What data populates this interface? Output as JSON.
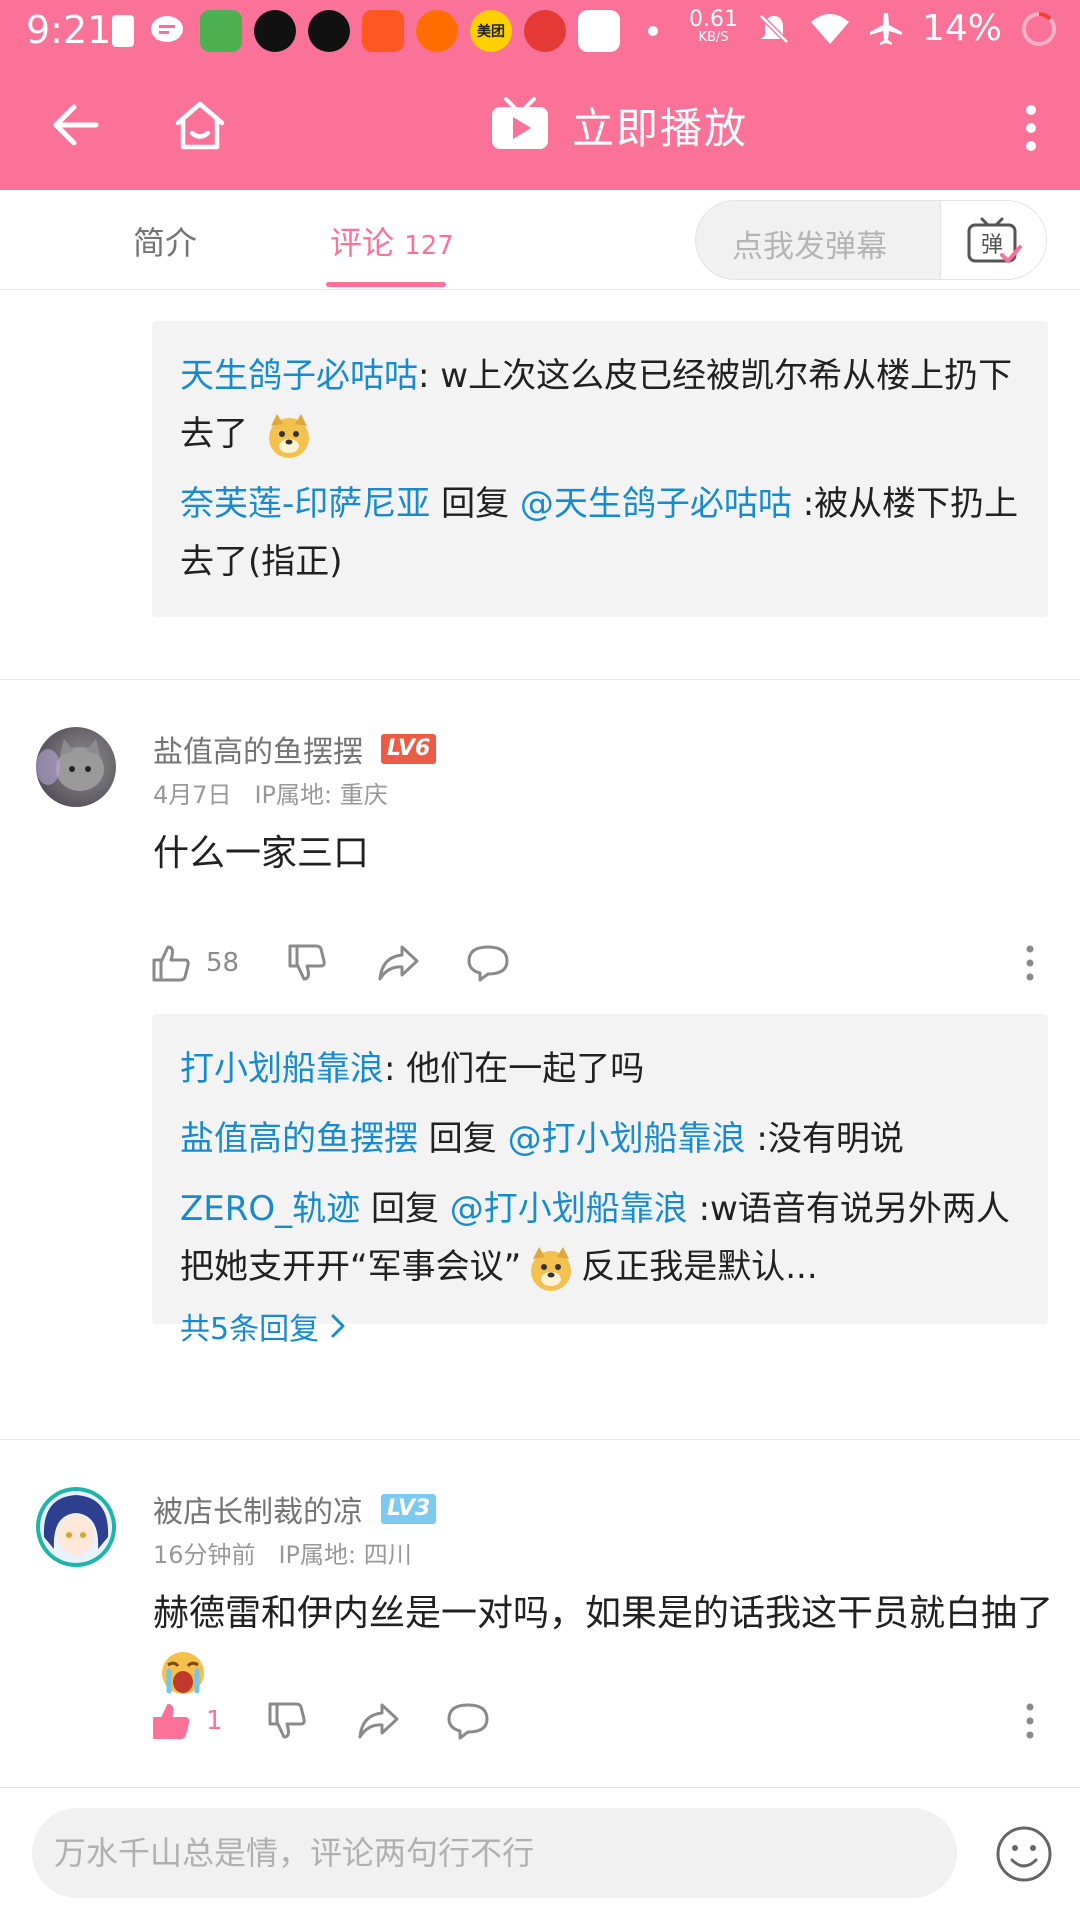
{
  "status": {
    "time": "9:21",
    "net_speed_value": "0.61",
    "net_speed_unit": "KB/S",
    "battery": "14%",
    "meituan_label": "美团"
  },
  "header": {
    "title": "立即播放"
  },
  "tabs": {
    "intro": "简介",
    "comments": "评论",
    "comments_count": "127",
    "danmaku_placeholder": "点我发弹幕",
    "danmaku_icon_char": "弹"
  },
  "top_replies": [
    {
      "user": "天生鸽子必咕咕",
      "text": ": w上次这么皮已经被凯尔希从楼上扔下去了"
    },
    {
      "user": "奈芙莲-印萨尼亚",
      "reply_word": " 回复 ",
      "target": "@天生鸽子必咕咕",
      "text": " :被从楼下扔上去了(指正)"
    }
  ],
  "comments": [
    {
      "user": "盐值高的鱼摆摆",
      "level": "LV6",
      "level_color": "#ee5b45",
      "date": "4月7日",
      "ip": "IP属地: 重庆",
      "text": "什么一家三口",
      "likes": "58",
      "replies": [
        {
          "user": "打小划船靠浪",
          "text": ": 他们在一起了吗"
        },
        {
          "user": "盐值高的鱼摆摆",
          "reply_word": " 回复 ",
          "target": "@打小划船靠浪",
          "text": " :没有明说"
        },
        {
          "user": "ZERO_轨迹",
          "reply_word": " 回复 ",
          "target": "@打小划船靠浪",
          "text": " :w语音有说另外两人把她支开开“军事会议”",
          "text2": "反正我是默认..."
        }
      ],
      "all_replies": "共5条回复"
    },
    {
      "user": "被店长制裁的凉",
      "level": "LV3",
      "level_color": "#7ccaf0",
      "date": "16分钟前",
      "ip": "IP属地: 四川",
      "text": "赫德雷和伊内丝是一对吗，如果是的话我这干员就白抽了",
      "likes": "1"
    }
  ],
  "bottom": {
    "placeholder": "万水千山总是情，评论两句行不行"
  },
  "colors": {
    "brand_pink": "#fb7299",
    "link_blue": "#178bcf"
  }
}
